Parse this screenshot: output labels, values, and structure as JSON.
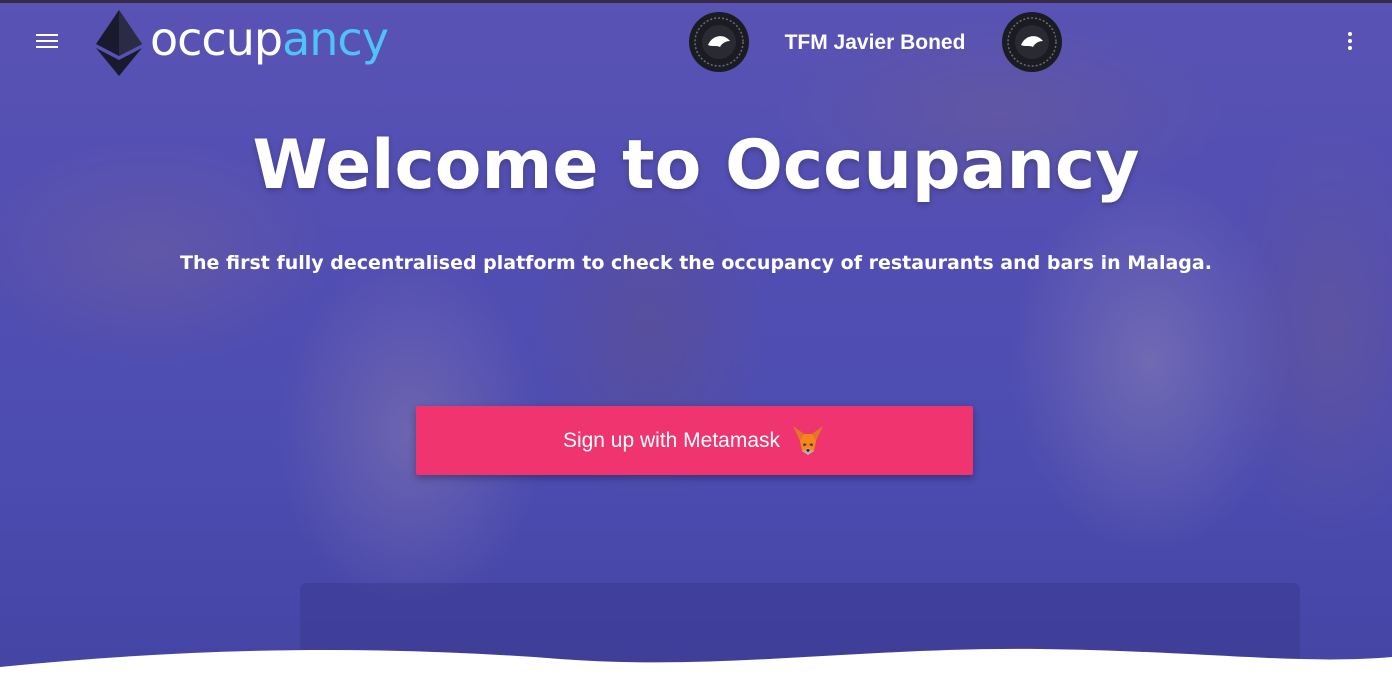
{
  "header": {
    "brand_part1": "occup",
    "brand_part2": "ancy",
    "title": "TFM Javier Boned",
    "menu_icon": "hamburger-menu-icon",
    "more_icon": "more-vertical-icon",
    "logo_icon": "ethereum-logo-icon",
    "seal_icon": "university-seal-icon"
  },
  "hero": {
    "title": "Welcome to Occupancy",
    "subtitle": "The first fully decentralised platform to check the occupancy of restaurants and bars in Malaga.",
    "cta_label": "Sign up with Metamask",
    "cta_icon": "metamask-fox-icon"
  },
  "colors": {
    "overlay": "#4848be",
    "cta": "#f0346f",
    "brand_accent": "#4fc3f7",
    "text": "#ffffff"
  }
}
